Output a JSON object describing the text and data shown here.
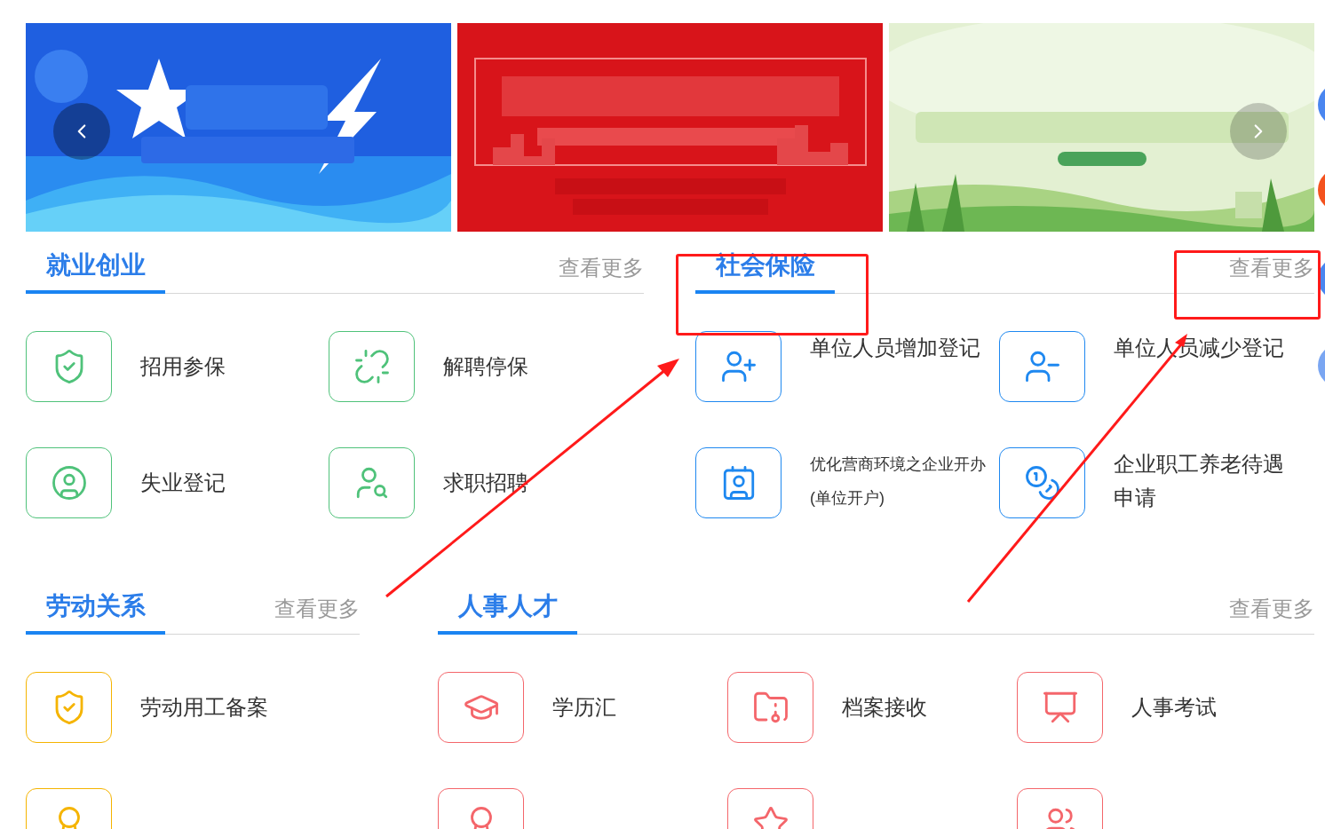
{
  "sections": [
    {
      "title": "就业创业",
      "more": "查看更多",
      "color": "#4fc27a",
      "items": [
        {
          "label": "招用参保",
          "kind": "normal"
        },
        {
          "label": "解聘停保",
          "kind": "normal"
        },
        {
          "label": "失业登记",
          "kind": "normal"
        },
        {
          "label": "求职招聘",
          "kind": "normal"
        }
      ]
    },
    {
      "title": "社会保险",
      "more": "查看更多",
      "color": "#1e88f0",
      "items": [
        {
          "label": "单位人员增加登记",
          "kind": "normal"
        },
        {
          "label": "单位人员减少登记",
          "kind": "normal"
        },
        {
          "label": "优化营商环境之企业开办(单位开户)",
          "kind": "compact"
        },
        {
          "label": "企业职工养老待遇申请",
          "kind": "normal"
        }
      ]
    },
    {
      "title": "劳动关系",
      "more": "查看更多",
      "color": "#f5b400",
      "items": [
        {
          "label": "劳动用工备案",
          "kind": "normal"
        },
        {
          "kind": "normal"
        }
      ]
    },
    {
      "title": "人事人才",
      "more": "查看更多",
      "color": "#f4666b",
      "items": [
        {
          "label": "学历汇",
          "kind": "normal"
        },
        {
          "label": "档案接收",
          "kind": "normal"
        },
        {
          "label": "人事考试",
          "kind": "normal"
        },
        {
          "kind": "normal"
        },
        {
          "kind": "normal"
        },
        {
          "kind": "normal"
        }
      ]
    }
  ],
  "annotations": [
    {
      "kind": "box"
    },
    {
      "kind": "box"
    },
    {
      "kind": "arrow"
    },
    {
      "kind": "arrow"
    }
  ]
}
